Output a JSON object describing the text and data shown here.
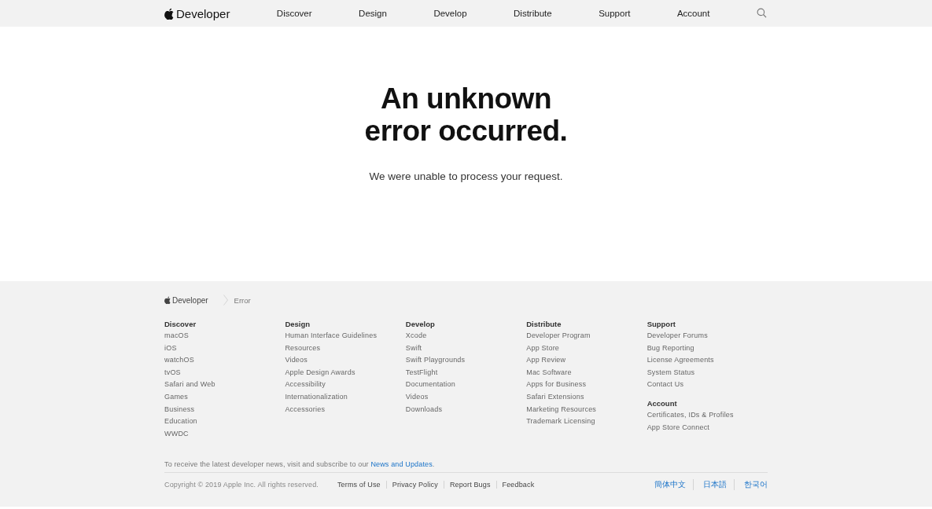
{
  "nav": {
    "brand": "Developer",
    "items": [
      {
        "label": "Discover"
      },
      {
        "label": "Design"
      },
      {
        "label": "Develop"
      },
      {
        "label": "Distribute"
      },
      {
        "label": "Support"
      },
      {
        "label": "Account"
      }
    ]
  },
  "error": {
    "title": "An unknown error occurred.",
    "message": "We were unable to process your request."
  },
  "footer": {
    "breadcrumbs": {
      "brand": "Developer",
      "current": "Error"
    },
    "columns": [
      {
        "sections": [
          {
            "heading": "Discover",
            "links": [
              "macOS",
              "iOS",
              "watchOS",
              "tvOS",
              "Safari and Web",
              "Games",
              "Business",
              "Education",
              "WWDC"
            ]
          }
        ]
      },
      {
        "sections": [
          {
            "heading": "Design",
            "links": [
              "Human Interface Guidelines",
              "Resources",
              "Videos",
              "Apple Design Awards",
              "Accessibility",
              "Internationalization",
              "Accessories"
            ]
          }
        ]
      },
      {
        "sections": [
          {
            "heading": "Develop",
            "links": [
              "Xcode",
              "Swift",
              "Swift Playgrounds",
              "TestFlight",
              "Documentation",
              "Videos",
              "Downloads"
            ]
          }
        ]
      },
      {
        "sections": [
          {
            "heading": "Distribute",
            "links": [
              "Developer Program",
              "App Store",
              "App Review",
              "Mac Software",
              "Apps for Business",
              "Safari Extensions",
              "Marketing Resources",
              "Trademark Licensing"
            ]
          }
        ]
      },
      {
        "sections": [
          {
            "heading": "Support",
            "links": [
              "Developer Forums",
              "Bug Reporting",
              "License Agreements",
              "System Status",
              "Contact Us"
            ]
          },
          {
            "heading": "Account",
            "links": [
              "Certificates, IDs & Profiles",
              "App Store Connect"
            ]
          }
        ]
      }
    ],
    "newsletter": {
      "text": "To receive the latest developer news, visit and subscribe to our",
      "link": "News and Updates",
      "end": "."
    },
    "copyright": "Copyright © 2019 Apple Inc. All rights reserved.",
    "legal_links": [
      "Terms of Use",
      "Privacy Policy",
      "Report Bugs",
      "Feedback"
    ],
    "languages": [
      "簡体中文",
      "日本語",
      "한국어"
    ]
  }
}
